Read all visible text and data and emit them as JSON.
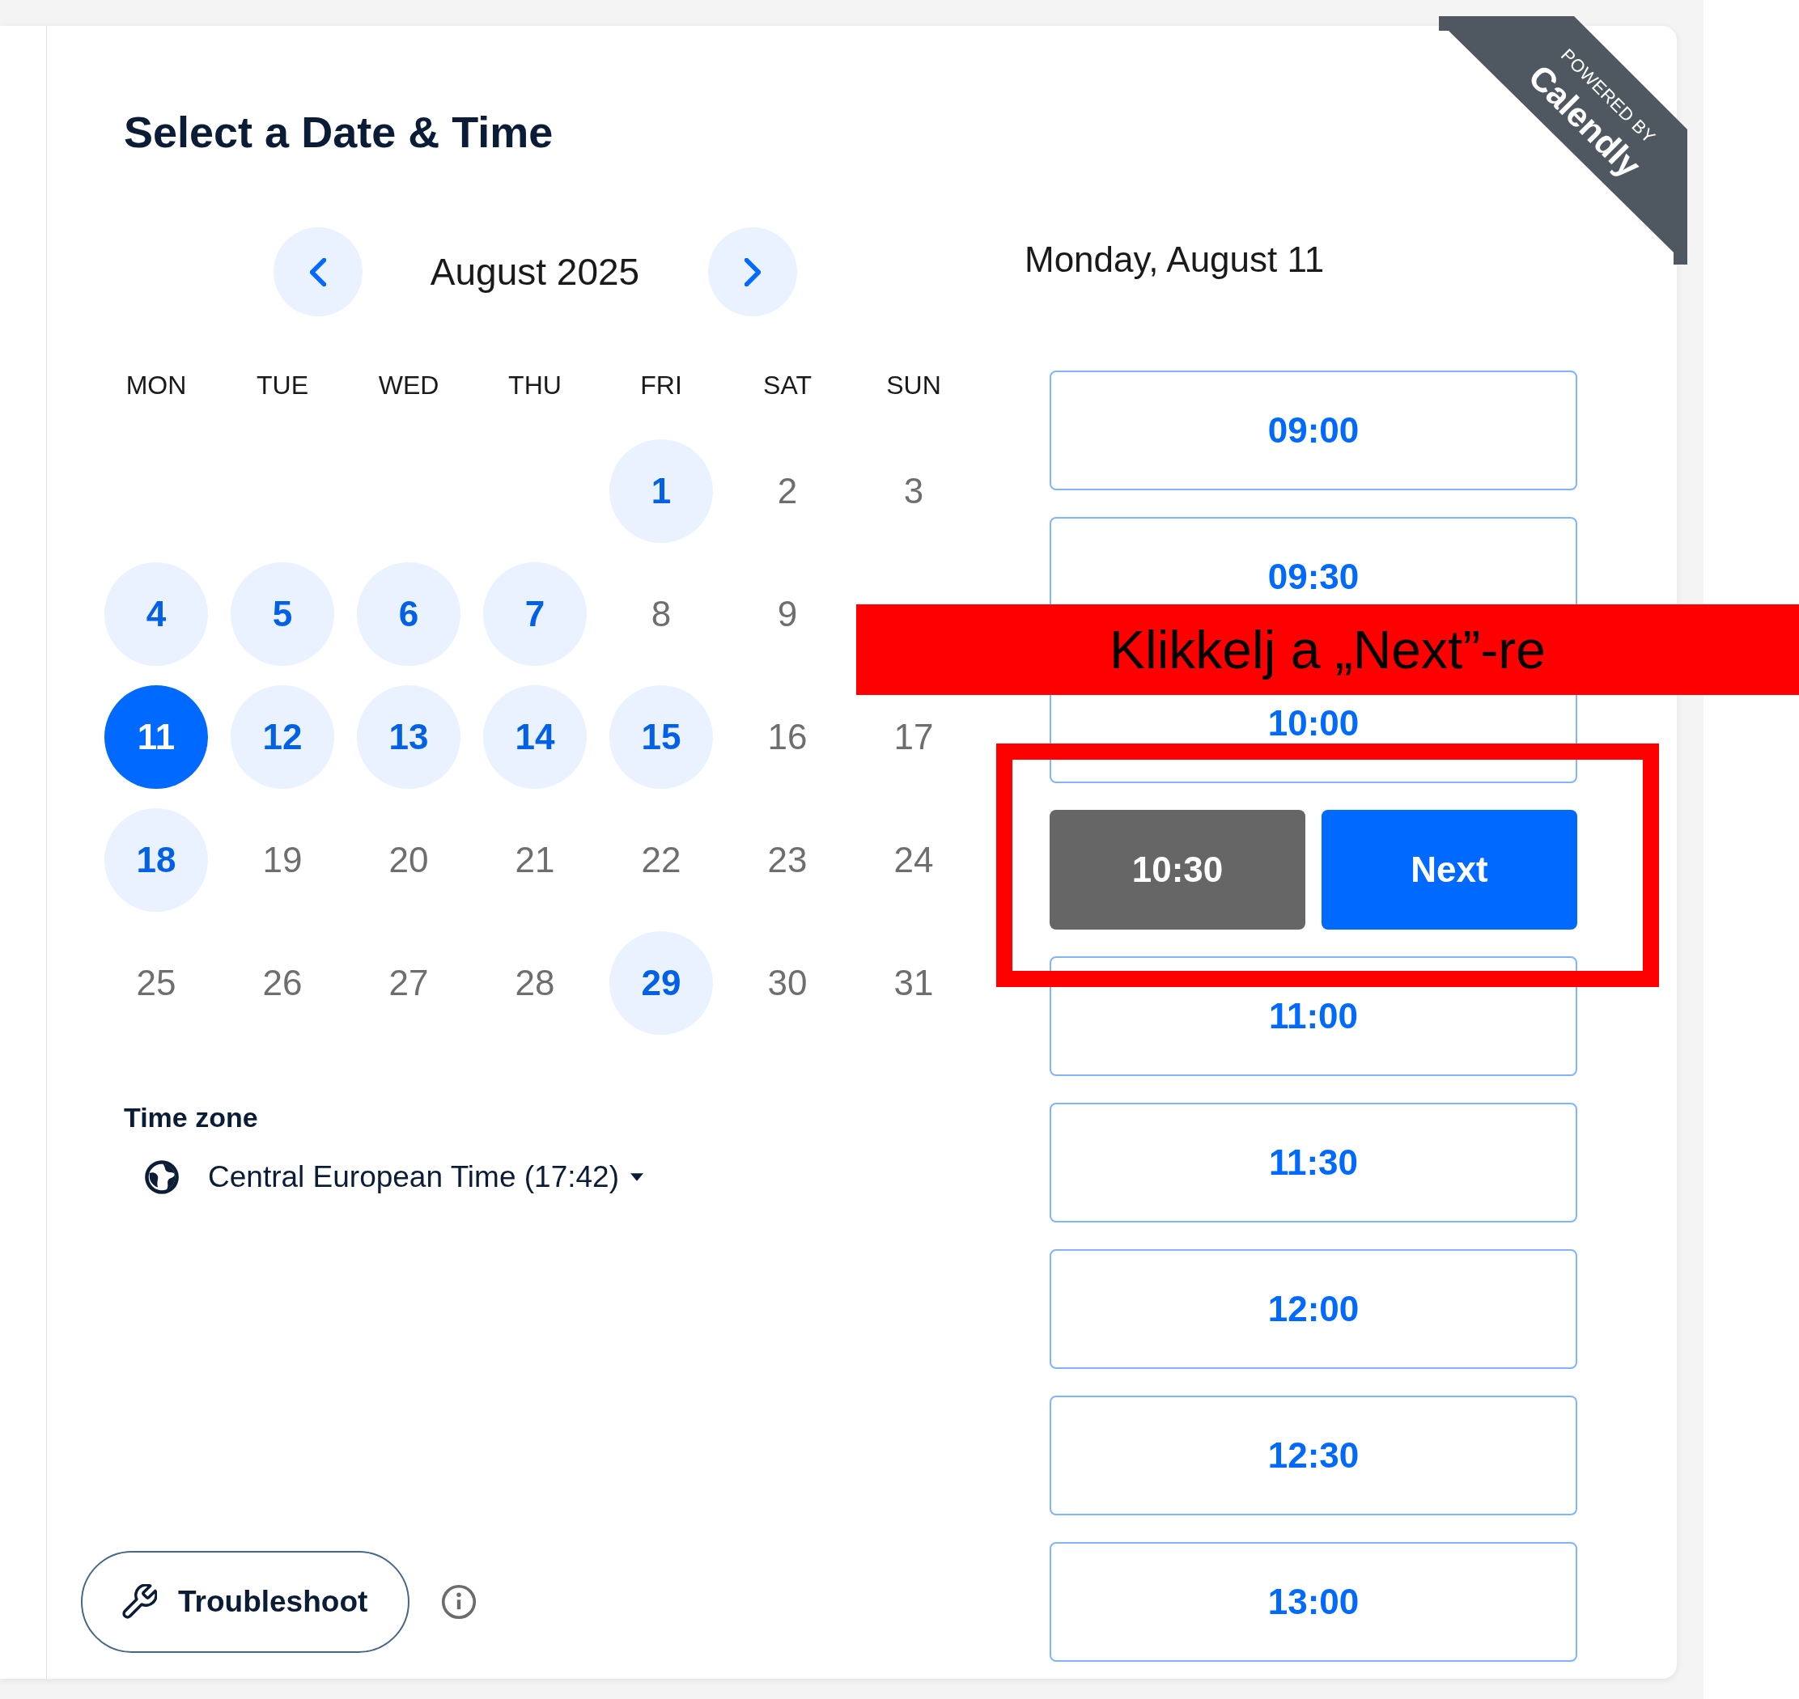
{
  "ribbon": {
    "caption": "POWERED BY",
    "brand": "Calendly"
  },
  "title": "Select a Date & Time",
  "calendar": {
    "month": "August 2025",
    "weekdays": [
      "MON",
      "TUE",
      "WED",
      "THU",
      "FRI",
      "SAT",
      "SUN"
    ],
    "weeks": [
      [
        {
          "day": "1",
          "available": true,
          "selected": false
        },
        {
          "day": "2",
          "available": false,
          "selected": false
        },
        {
          "day": "3",
          "available": false,
          "selected": false
        }
      ],
      [
        {
          "day": "4",
          "available": true,
          "selected": false
        },
        {
          "day": "5",
          "available": true,
          "selected": false
        },
        {
          "day": "6",
          "available": true,
          "selected": false
        },
        {
          "day": "7",
          "available": true,
          "selected": false
        },
        {
          "day": "8",
          "available": false,
          "selected": false
        },
        {
          "day": "9",
          "available": false,
          "selected": false
        }
      ],
      [
        {
          "day": "11",
          "available": true,
          "selected": true
        },
        {
          "day": "12",
          "available": true,
          "selected": false
        },
        {
          "day": "13",
          "available": true,
          "selected": false
        },
        {
          "day": "14",
          "available": true,
          "selected": false
        },
        {
          "day": "15",
          "available": true,
          "selected": false
        },
        {
          "day": "16",
          "available": false,
          "selected": false
        },
        {
          "day": "17",
          "available": false,
          "selected": false
        }
      ],
      [
        {
          "day": "18",
          "available": true,
          "selected": false
        },
        {
          "day": "19",
          "available": false,
          "selected": false
        },
        {
          "day": "20",
          "available": false,
          "selected": false
        },
        {
          "day": "21",
          "available": false,
          "selected": false
        },
        {
          "day": "22",
          "available": false,
          "selected": false
        },
        {
          "day": "23",
          "available": false,
          "selected": false
        },
        {
          "day": "24",
          "available": false,
          "selected": false
        }
      ],
      [
        {
          "day": "25",
          "available": false,
          "selected": false
        },
        {
          "day": "26",
          "available": false,
          "selected": false
        },
        {
          "day": "27",
          "available": false,
          "selected": false
        },
        {
          "day": "28",
          "available": false,
          "selected": false
        },
        {
          "day": "29",
          "available": true,
          "selected": false
        },
        {
          "day": "30",
          "available": false,
          "selected": false
        },
        {
          "day": "31",
          "available": false,
          "selected": false
        }
      ]
    ]
  },
  "timezone": {
    "label": "Time zone",
    "value": "Central European Time (17:42)"
  },
  "troubleshoot": {
    "label": "Troubleshoot"
  },
  "schedule": {
    "date": "Monday, August 11",
    "confirm_label": "Next",
    "slots": [
      {
        "time": "09:00",
        "selected": false
      },
      {
        "time": "09:30",
        "selected": false
      },
      {
        "time": "10:00",
        "selected": false
      },
      {
        "time": "10:30",
        "selected": true
      },
      {
        "time": "11:00",
        "selected": false
      },
      {
        "time": "11:30",
        "selected": false
      },
      {
        "time": "12:00",
        "selected": false
      },
      {
        "time": "12:30",
        "selected": false
      },
      {
        "time": "13:00",
        "selected": false
      }
    ]
  },
  "annotation": {
    "text": "Klikkelj a „Next”-re",
    "framed": true
  }
}
